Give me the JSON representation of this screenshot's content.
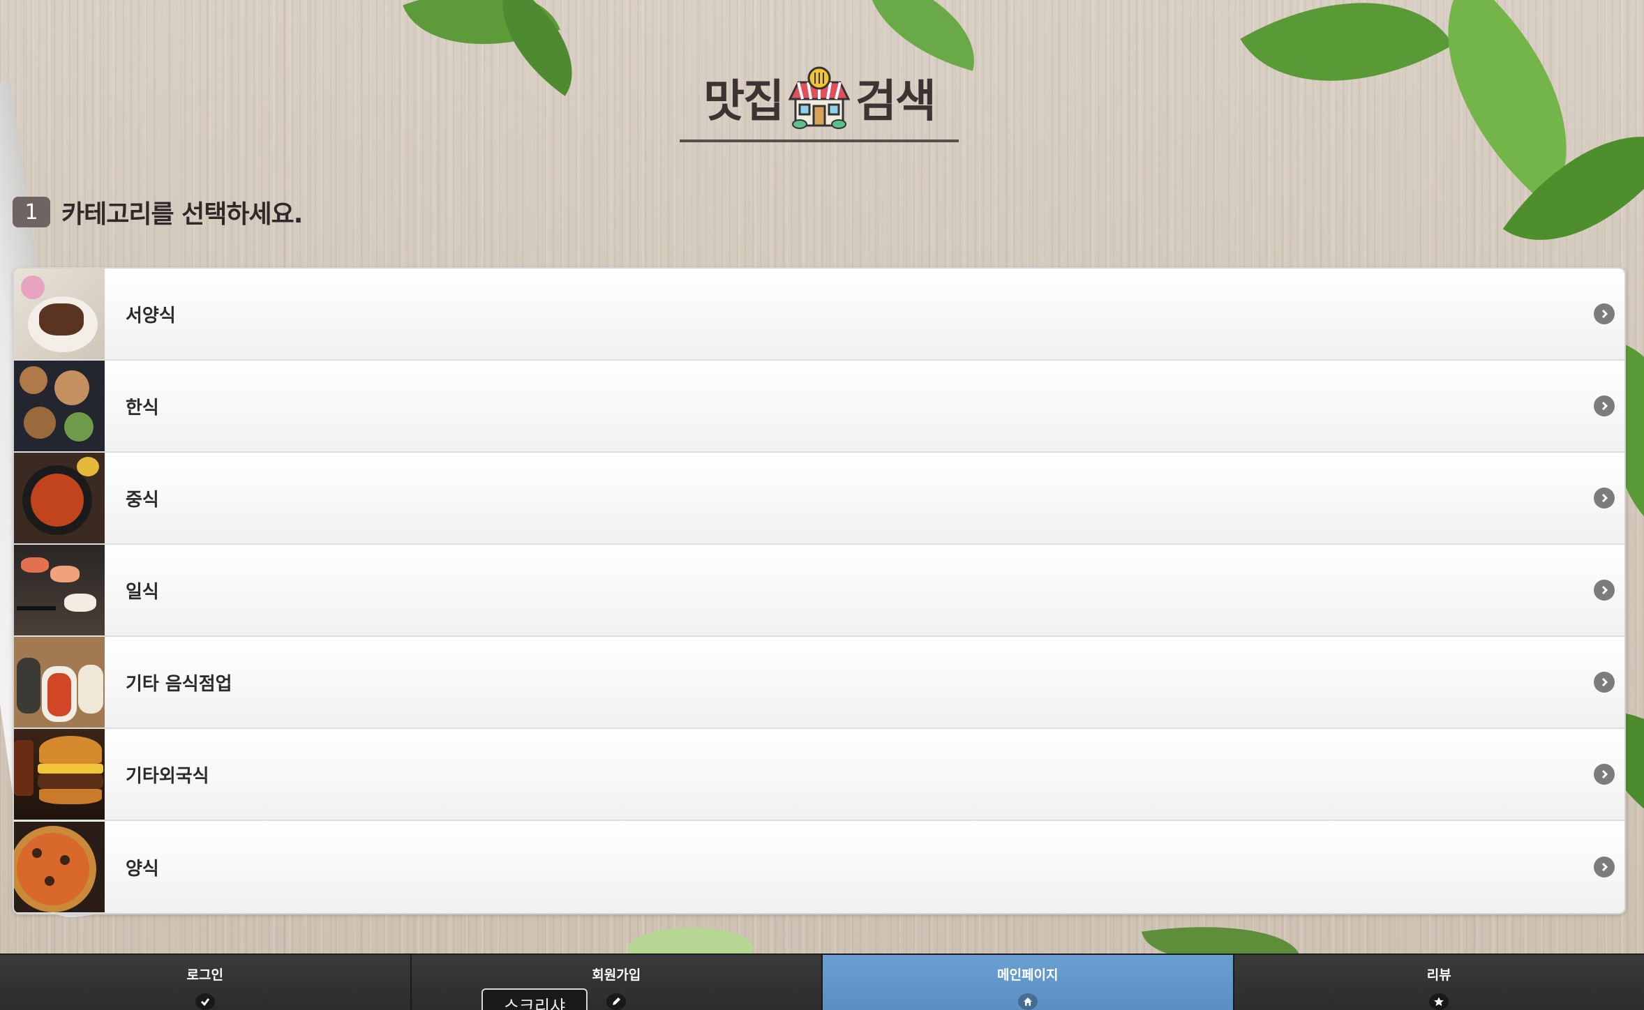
{
  "header": {
    "title_left": "맛집",
    "title_right": "검색"
  },
  "section": {
    "step_number": "1",
    "instruction": "카테고리를 선택하세요."
  },
  "categories": [
    {
      "label": "서양식",
      "thumb": "steak-photo"
    },
    {
      "label": "한식",
      "thumb": "korean-dishes-photo"
    },
    {
      "label": "중식",
      "thumb": "chinese-noodle-photo"
    },
    {
      "label": "일식",
      "thumb": "sushi-photo"
    },
    {
      "label": "기타 음식점업",
      "thumb": "tteokbokki-photo"
    },
    {
      "label": "기타외국식",
      "thumb": "burger-photo"
    },
    {
      "label": "양식",
      "thumb": "pizza-photo"
    }
  ],
  "tabs": [
    {
      "label": "로그인",
      "icon": "check-icon",
      "active": false
    },
    {
      "label": "회원가입",
      "icon": "pencil-icon",
      "active": false
    },
    {
      "label": "메인페이지",
      "icon": "home-icon",
      "active": true
    },
    {
      "label": "리뷰",
      "icon": "star-icon",
      "active": false
    }
  ],
  "overlay": {
    "screenshot_button": "스크리샤"
  },
  "colors": {
    "active_tab": "#6a9fd2",
    "tab_bar": "#2b2b2b",
    "step_badge": "#6e6464",
    "title_text": "#3b3433"
  }
}
